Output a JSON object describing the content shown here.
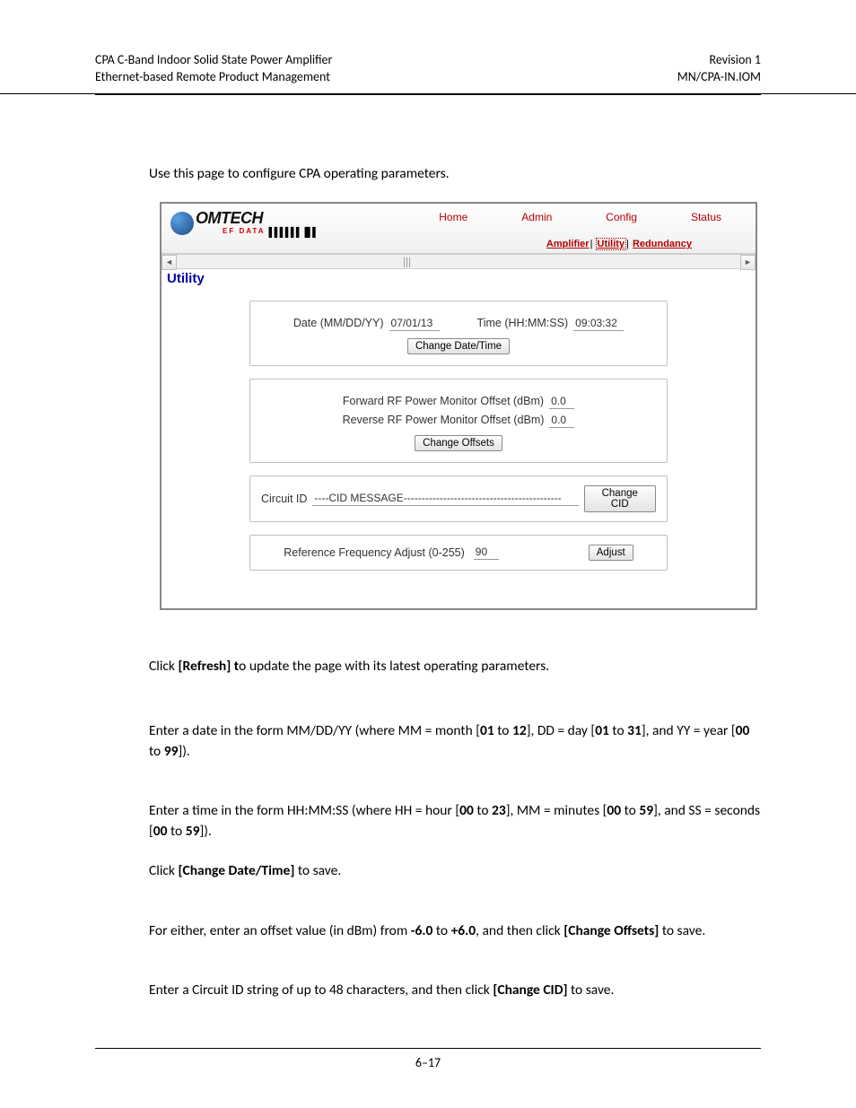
{
  "header": {
    "left1": "CPA C-Band Indoor Solid State Power Amplifier",
    "left2": "Ethernet-based Remote Product Management",
    "right1": "Revision 1",
    "right2": "MN/CPA-IN.IOM"
  },
  "intro": "Use this page to configure CPA operating parameters.",
  "screenshot": {
    "logo": {
      "name": "OMTECH",
      "ef": "EF DATA",
      "bars": "▌▌▌▌▌▌▐▌▌"
    },
    "nav": {
      "home": "Home",
      "admin": "Admin",
      "config": "Config",
      "status": "Status"
    },
    "subnav": {
      "amplifier": "Amplifier",
      "utility": "Utility",
      "redundancy": "Redundancy"
    },
    "page_title": "Utility",
    "date_label": "Date (MM/DD/YY)",
    "date_value": "07/01/13",
    "time_label": "Time (HH:MM:SS)",
    "time_value": "09:03:32",
    "change_datetime": "Change Date/Time",
    "fwd_label": "Forward RF Power Monitor Offset (dBm)",
    "fwd_value": "0.0",
    "rev_label": "Reverse RF Power Monitor Offset (dBm)",
    "rev_value": "0.0",
    "change_offsets": "Change Offsets",
    "cid_label": "Circuit ID",
    "cid_value": "----CID MESSAGE--------------------------------------------",
    "change_cid": "Change CID",
    "ref_label": "Reference Frequency Adjust (0-255)",
    "ref_value": "90",
    "adjust": "Adjust"
  },
  "body": {
    "refresh_pre": "Click ",
    "refresh_bold": "[Refresh] t",
    "refresh_post": "o update the page with its latest operating parameters.",
    "date_p1": "Enter a date in the form MM/DD/YY (where MM = month [",
    "date_b1": "01",
    "date_p2": " to ",
    "date_b2": "12",
    "date_p3": "], DD = day [",
    "date_b3": "01",
    "date_p4": " to ",
    "date_b4": "31",
    "date_p5": "], and YY = year [",
    "date_b5": "00",
    "date_p6": " to ",
    "date_b6": "99",
    "date_p7": "]).",
    "time_p1": "Enter a time in the form HH:MM:SS (where HH = hour [",
    "time_b1": "00",
    "time_p2": " to ",
    "time_b2": "23",
    "time_p3": "], MM = minutes [",
    "time_b3": "00",
    "time_p4": " to ",
    "time_b4": "59",
    "time_p5": "], and SS = seconds [",
    "time_b5": "00",
    "time_p6": " to ",
    "time_b6": "59",
    "time_p7": "]).",
    "cdt_pre": "Click ",
    "cdt_bold": "[Change Date/Time]",
    "cdt_post": " to save.",
    "off_p1": "For either, enter an offset value (in dBm) from ",
    "off_b1": "-6.0",
    "off_p2": " to ",
    "off_b2": "+6.0",
    "off_p3": ", and then click ",
    "off_b3": "[Change Offsets]",
    "off_p4": " to save.",
    "cid_p1": "Enter a Circuit ID string of up to 48 characters, and then click ",
    "cid_b1": "[Change CID]",
    "cid_p2": " to save."
  },
  "footer": {
    "page": "6–17"
  }
}
